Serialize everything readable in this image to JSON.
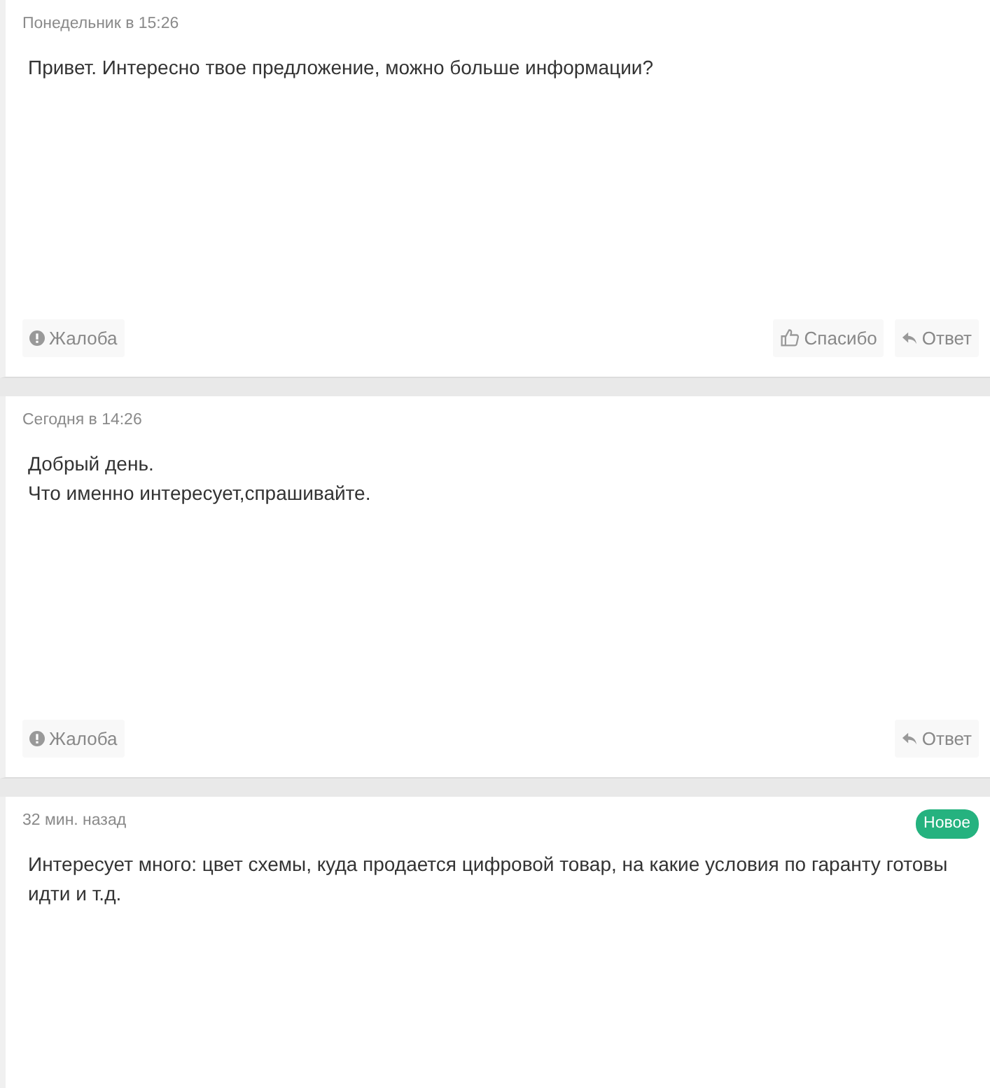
{
  "posts": [
    {
      "time": "Понедельник в 15:26",
      "lines": [
        "Привет. Интересно твое предложение, можно больше информации?"
      ],
      "actions": [
        {
          "kind": "report",
          "label": "Жалоба"
        },
        {
          "kind": "thanks",
          "label": "Спасибо"
        },
        {
          "kind": "reply",
          "label": "Ответ"
        }
      ]
    },
    {
      "time": "Сегодня в 14:26",
      "lines": [
        "Добрый день.",
        "Что именно интересует,спрашивайте."
      ],
      "actions": [
        {
          "kind": "report",
          "label": "Жалоба"
        },
        {
          "kind": "reply",
          "label": "Ответ"
        }
      ]
    },
    {
      "time": "32 мин. назад",
      "badge": "Новое",
      "lines": [
        "Интересует много: цвет схемы, куда продается цифровой товар, на какие условия по гаранту готовы идти и т.д."
      ]
    }
  ]
}
